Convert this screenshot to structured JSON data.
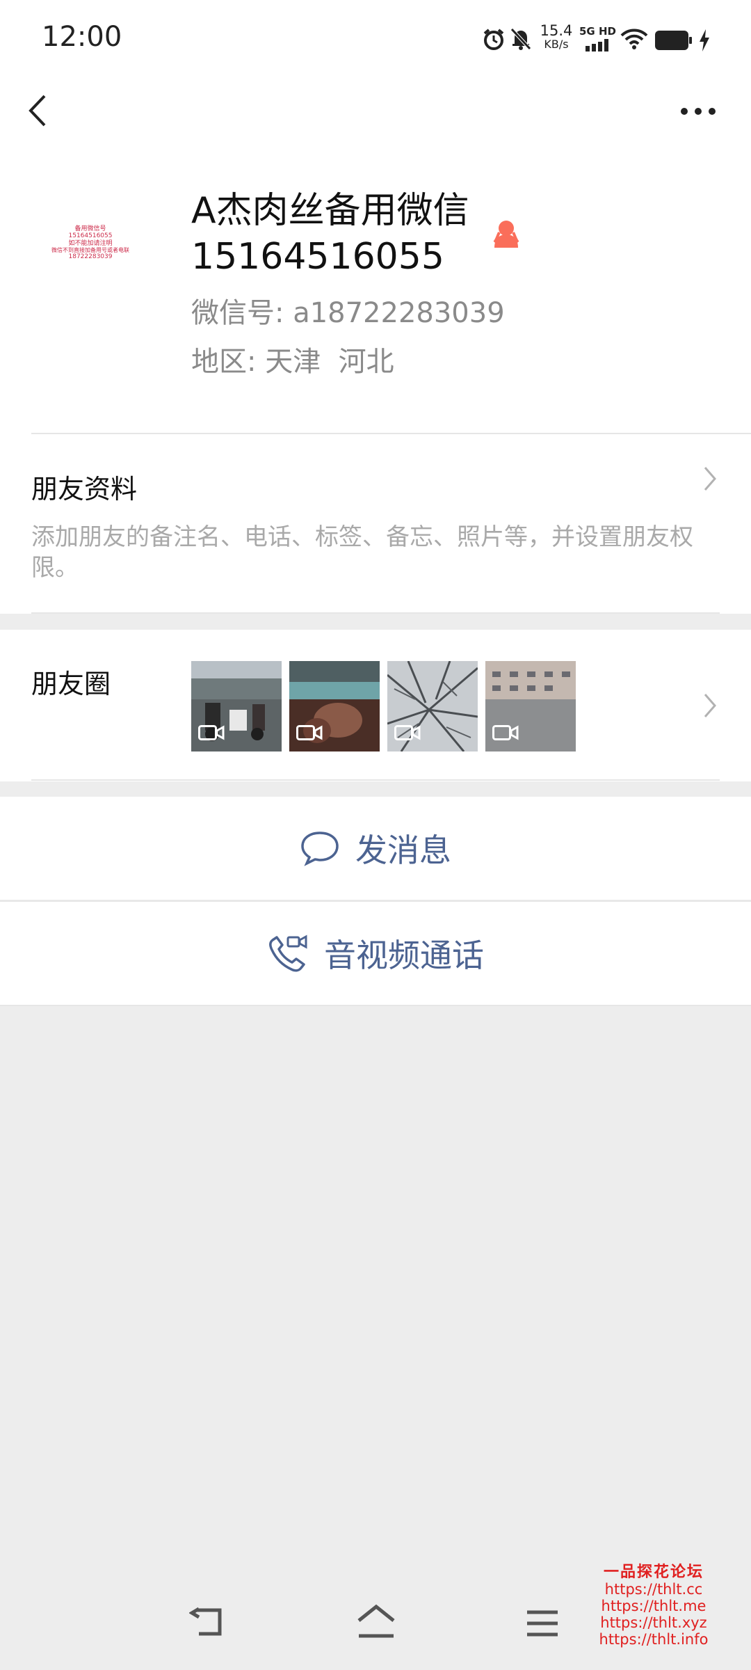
{
  "status_bar": {
    "time": "12:00",
    "net_speed_value": "15.4",
    "net_speed_unit": "KB/s",
    "network": "5G HD",
    "icons": [
      "alarm-icon",
      "mute-icon",
      "wifi-icon",
      "battery-icon",
      "charging-icon"
    ]
  },
  "nav": {
    "back_icon": "chevron-left-icon",
    "more_icon": "more-icon"
  },
  "profile": {
    "name_line1": "A杰肉丝备用微信",
    "name_line2": "15164516055",
    "gender_icon": "female-icon",
    "wechat_id_label": "微信号: a18722283039",
    "region_label": "地区: 天津  河北",
    "avatar_lines": [
      "备用微信号",
      "15164516055",
      "如不能加请注明",
      "微信不到直接加备用号或者电联",
      "18722283039"
    ]
  },
  "friend_info": {
    "title": "朋友资料",
    "description": "添加朋友的备注名、电话、标签、备忘、照片等，并设置朋友权限。"
  },
  "moments": {
    "title": "朋友圈",
    "thumbnails": [
      {
        "type": "video",
        "scene": "street-scene"
      },
      {
        "type": "video",
        "scene": "blurred-interior"
      },
      {
        "type": "video",
        "scene": "snowy-branches"
      },
      {
        "type": "video",
        "scene": "building-facade"
      }
    ]
  },
  "actions": {
    "send_message": "发消息",
    "av_call": "音视频通话"
  },
  "watermark": {
    "title": "一品探花论坛",
    "links": [
      "https://thlt.cc",
      "https://thlt.me",
      "https://thlt.xyz",
      "https://thlt.info"
    ]
  },
  "colors": {
    "accent": "#4c6391",
    "background": "#ededed",
    "female_icon": "#fa6e5a",
    "watermark": "#e02020"
  }
}
